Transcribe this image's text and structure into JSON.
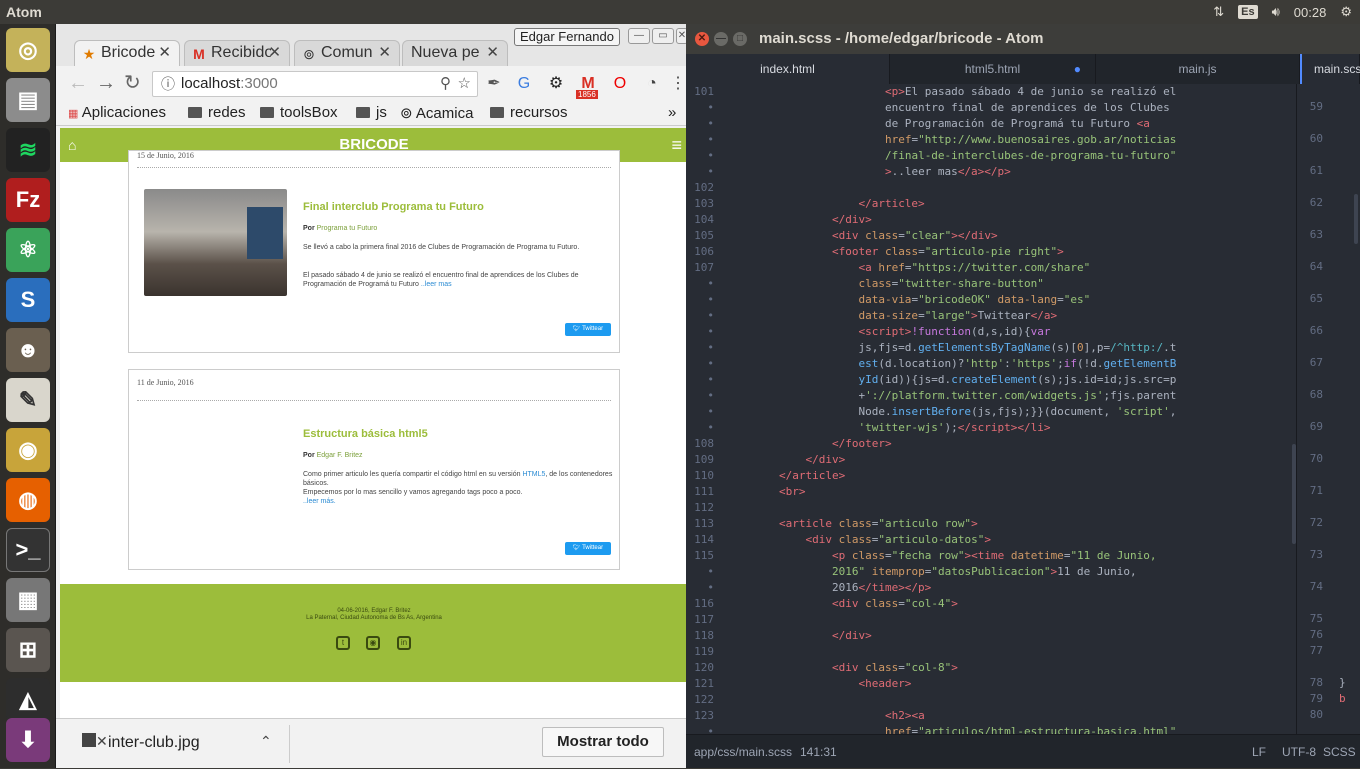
{
  "topbar": {
    "app": "Atom",
    "keyboard": "Es",
    "clock": "00:28"
  },
  "chrome": {
    "tabs": [
      {
        "label": "Bricode",
        "icon": "★"
      },
      {
        "label": "Recibido",
        "icon": "M"
      },
      {
        "label": "Comun",
        "icon": "⊚"
      },
      {
        "label": "Nueva pe",
        "icon": ""
      }
    ],
    "user": "Edgar Fernando",
    "url": {
      "host": "localhost",
      "port": ":3000"
    },
    "gmail_badge": "1856",
    "bookmarks": [
      "Aplicaciones",
      "redes",
      "toolsBox",
      "js",
      "Acamica",
      "recursos"
    ],
    "page": {
      "site_title": "BRICODE",
      "post1": {
        "date": "15 de Junio, 2016",
        "title": "Final interclub Programa tu Futuro",
        "by_prefix": "Por",
        "author": "Programa tu Futuro",
        "p1": "Se llevó a cabo la primera final 2016 de Clubes de Programación de Programa tu Futuro.",
        "p2": "El pasado sábado 4 de junio se realizó el encuentro final de aprendices de los Clubes de Programación de Programá tu Futuro",
        "more": "..leer mas",
        "tweet": "Twittear"
      },
      "post2": {
        "date": "11 de Junio, 2016",
        "title": "Estructura básica html5",
        "by_prefix": "Por",
        "author": "Edgar F. Britez",
        "p1a": "Como primer articulo les quería compartir el código html en su versión",
        "html5": "HTML5",
        "p1b": ", de los contenedores básicos.",
        "p2": "Empecemos por lo mas sencillo y vamos agregando tags poco a poco.",
        "more": "..leer más.",
        "tweet": "Twittear"
      },
      "footer": {
        "line1": "04-06-2016, Edgar F. Britez",
        "line2": "La Paternal, Ciudad Autonoma de Bs As, Argentina"
      }
    },
    "download": {
      "file": "inter-club.jpg",
      "show_all": "Mostrar todo"
    }
  },
  "atom": {
    "title": "main.scss - /home/edgar/bricode - Atom",
    "tabs": [
      "index.html",
      "html5.html",
      "main.js",
      "main.scss"
    ],
    "status": {
      "path": "app/css/main.scss",
      "pos": "141:31",
      "eol": "LF",
      "enc": "UTF-8",
      "grammar": "SCSS"
    },
    "split_lines": [
      "59",
      "60",
      "61",
      "62",
      "63",
      "64",
      "65",
      "66",
      "67",
      "68",
      "69",
      "70",
      "71",
      "72",
      "73",
      "74",
      "75",
      "76",
      "77",
      "78",
      "79",
      "80"
    ]
  },
  "colors": {
    "brand": "#9cbd3b",
    "editor_bg": "#282c34"
  }
}
